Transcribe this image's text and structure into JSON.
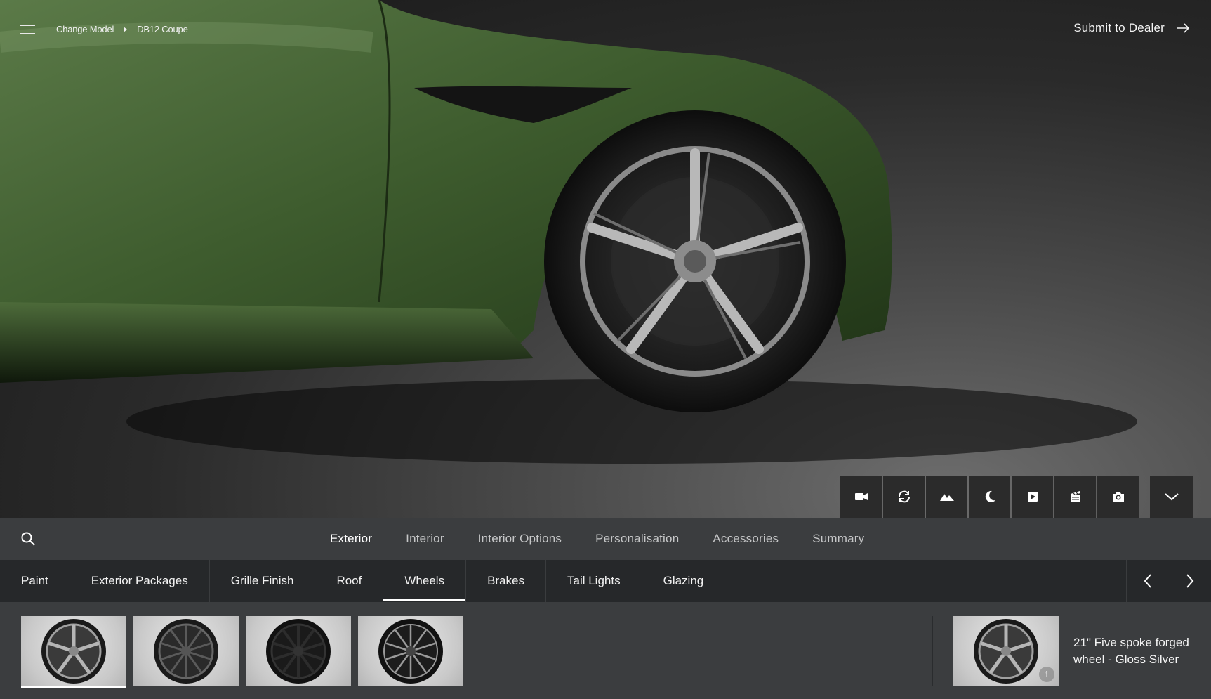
{
  "header": {
    "breadcrumb": [
      "Change Model",
      "DB12 Coupe"
    ],
    "submit_label": "Submit to Dealer"
  },
  "view_controls": [
    {
      "icon": "video-camera-icon"
    },
    {
      "icon": "rotate-icon"
    },
    {
      "icon": "landscape-icon"
    },
    {
      "icon": "moon-icon"
    },
    {
      "icon": "play-icon"
    },
    {
      "icon": "clapperboard-icon"
    },
    {
      "icon": "camera-icon"
    }
  ],
  "collapse_icon": "chevron-down-icon",
  "category_tabs": [
    "Exterior",
    "Interior",
    "Interior Options",
    "Personalisation",
    "Accessories",
    "Summary"
  ],
  "active_category": "Exterior",
  "sub_tabs": [
    "Paint",
    "Exterior Packages",
    "Grille Finish",
    "Roof",
    "Wheels",
    "Brakes",
    "Tail Lights",
    "Glazing"
  ],
  "active_sub_tab": "Wheels",
  "wheel_options": [
    {
      "finish": "silver",
      "selected": true
    },
    {
      "finish": "dark grey",
      "selected": false
    },
    {
      "finish": "black",
      "selected": false
    },
    {
      "finish": "black diamond turned",
      "selected": false
    }
  ],
  "selected_option": {
    "name": "21\" Five spoke forged wheel - Gloss Silver",
    "info_glyph": "i"
  },
  "colors": {
    "paint": "#3c5a2c",
    "nav_bg": "#3b3d3f",
    "subnav_bg": "#26282a"
  }
}
